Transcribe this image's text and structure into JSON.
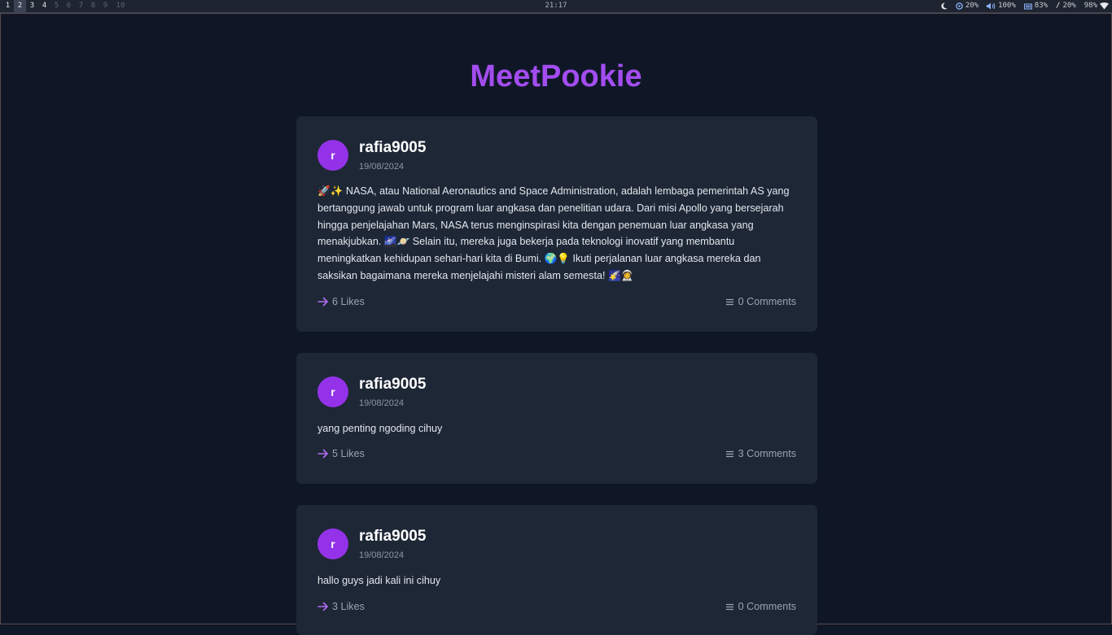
{
  "statusbar": {
    "workspaces": [
      "1",
      "2",
      "3",
      "4",
      "5",
      "6",
      "7",
      "8",
      "9",
      "10"
    ],
    "clock": "21:17",
    "tray": {
      "cpu": "20%",
      "volume": "100%",
      "memory": "83%",
      "disk": "20%",
      "battery": "98%"
    }
  },
  "app": {
    "title": "MeetPookie"
  },
  "posts": [
    {
      "avatar": "r",
      "username": "rafia9005",
      "date": "19/08/2024",
      "body": "🚀✨ NASA, atau National Aeronautics and Space Administration, adalah lembaga pemerintah AS yang bertanggung jawab untuk program luar angkasa dan penelitian udara. Dari misi Apollo yang bersejarah hingga penjelajahan Mars, NASA terus menginspirasi kita dengan penemuan luar angkasa yang menakjubkan. 🌌🪐 Selain itu, mereka juga bekerja pada teknologi inovatif yang membantu meningkatkan kehidupan sehari-hari kita di Bumi. 🌍💡 Ikuti perjalanan luar angkasa mereka dan saksikan bagaimana mereka menjelajahi misteri alam semesta! 🌠👩‍🚀",
      "likes": "6 Likes",
      "comments": "0 Comments"
    },
    {
      "avatar": "r",
      "username": "rafia9005",
      "date": "19/08/2024",
      "body": "yang penting ngoding cihuy",
      "likes": "5 Likes",
      "comments": "3 Comments"
    },
    {
      "avatar": "r",
      "username": "rafia9005",
      "date": "19/08/2024",
      "body": "hallo guys jadi kali ini cihuy",
      "likes": "3 Likes",
      "comments": "0 Comments"
    }
  ],
  "colors": {
    "background": "#0f1727",
    "card": "#1e2736",
    "accent": "#9332e8",
    "title": "#a34df0"
  }
}
